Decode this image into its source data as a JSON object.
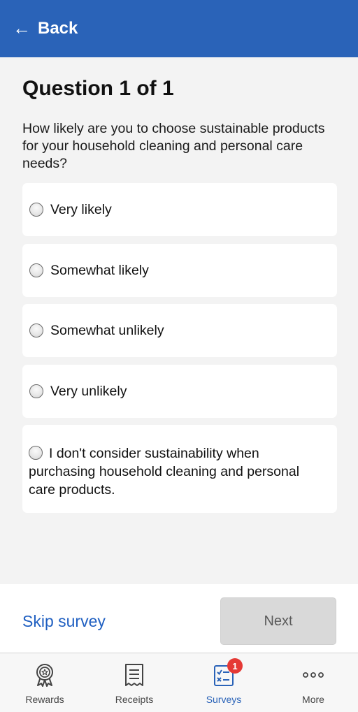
{
  "header": {
    "back_icon": "back-arrow-icon",
    "back_label": "Back",
    "color": "#2a63b8"
  },
  "question": {
    "title": "Question 1 of 1",
    "text": "How likely are you to choose sustainable products for your household cleaning and personal care needs?"
  },
  "options": [
    {
      "label": "Very likely"
    },
    {
      "label": "Somewhat likely"
    },
    {
      "label": "Somewhat unlikely"
    },
    {
      "label": "Very unlikely"
    },
    {
      "label": "I don't consider sustainability when purchasing household cleaning and personal care products."
    }
  ],
  "actions": {
    "skip_label": "Skip survey",
    "next_label": "Next"
  },
  "tabs": [
    {
      "label": "Rewards",
      "icon": "award-ribbon-icon"
    },
    {
      "label": "Receipts",
      "icon": "receipt-icon"
    },
    {
      "label": "Surveys",
      "icon": "survey-checklist-icon",
      "badge": "1",
      "active": true
    },
    {
      "label": "More",
      "icon": "more-dots-icon"
    }
  ]
}
